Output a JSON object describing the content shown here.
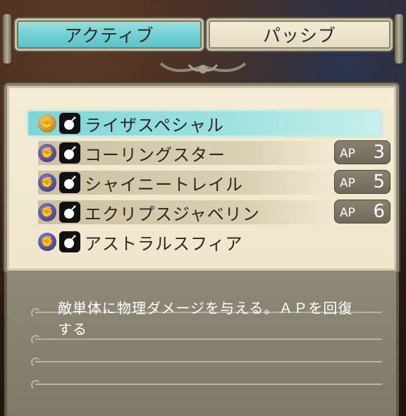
{
  "tabs": {
    "active_label": "アクティブ",
    "passive_label": "パッシブ"
  },
  "skills": [
    {
      "name": "ライザスペシャル",
      "type": "gold",
      "ap_label": "",
      "ap_value": ""
    },
    {
      "name": "コーリングスター",
      "type": "purple",
      "ap_label": "AP",
      "ap_value": "3"
    },
    {
      "name": "シャイニートレイル",
      "type": "purple",
      "ap_label": "AP",
      "ap_value": "5"
    },
    {
      "name": "エクリプスジャベリン",
      "type": "purple",
      "ap_label": "AP",
      "ap_value": "6"
    },
    {
      "name": "アストラルスフィア",
      "type": "purple",
      "ap_label": "",
      "ap_value": ""
    }
  ],
  "selected_index": 0,
  "description": {
    "line1": "敵単体に物理ダメージを与える。ＡＰを回復",
    "line2": "する"
  },
  "colors": {
    "active_tab": "#6ecfd3",
    "selected_row": "#9fe3e2",
    "panel": "#f1e8cf",
    "ap_badge": "#7c7564"
  },
  "icons": [
    "fist-icon",
    "bomb-icon"
  ]
}
